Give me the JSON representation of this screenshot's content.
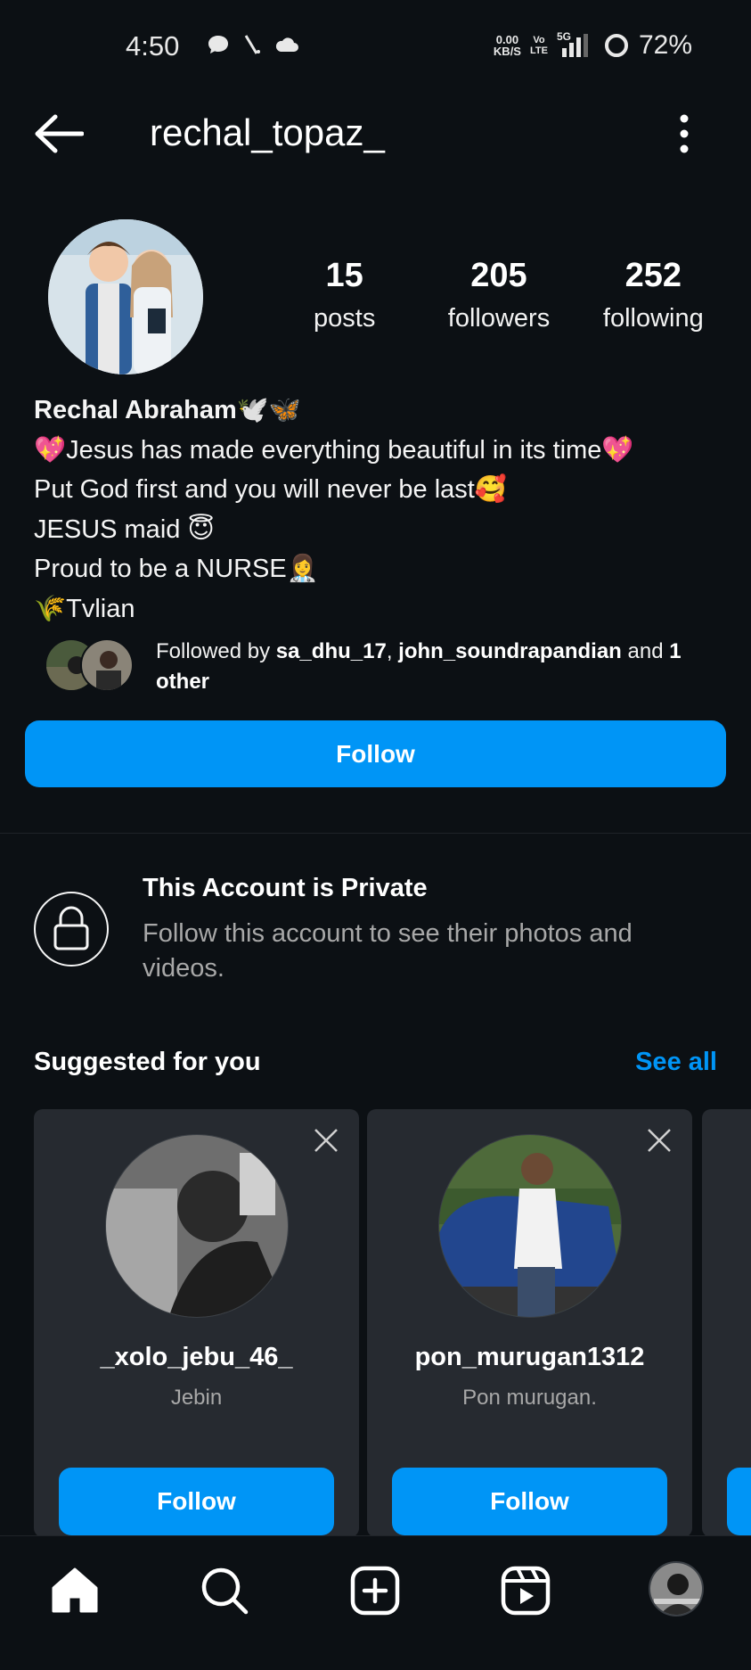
{
  "status_bar": {
    "time": "4:50",
    "net_speed_value": "0.00",
    "net_speed_unit": "KB/S",
    "volte_top": "Vo",
    "volte_bottom": "LTE",
    "network": "5G",
    "battery": "72%"
  },
  "header": {
    "username": "rechal_topaz_"
  },
  "profile": {
    "stats": [
      {
        "num": "15",
        "label": "posts"
      },
      {
        "num": "205",
        "label": "followers"
      },
      {
        "num": "252",
        "label": "following"
      }
    ],
    "name": "Rechal Abraham🕊️🦋",
    "bio": [
      "💖Jesus has made everything beautiful in its time💖",
      "Put God first and you will never be last🥰",
      "JESUS maid 😇",
      "Proud to be a NURSE👩‍⚕️",
      "🌾Tvlian"
    ],
    "followed_by": {
      "prefix": "Followed by ",
      "user1": "sa_dhu_17",
      "sep": ", ",
      "user2": "john_soundrapandian",
      "mid": " and ",
      "rest": "1 other"
    },
    "follow_label": "Follow"
  },
  "private": {
    "title": "This Account is Private",
    "subtitle": "Follow this account to see their photos and videos."
  },
  "suggested": {
    "title": "Suggested for you",
    "see_all": "See all",
    "cards": [
      {
        "username": "_xolo_jebu_46_",
        "name": "Jebin",
        "button": "Follow"
      },
      {
        "username": "pon_murugan1312",
        "name": "Pon murugan.",
        "button": "Follow"
      }
    ]
  },
  "nav": {
    "items": [
      "home-icon",
      "search-icon",
      "create-icon",
      "reels-icon",
      "profile-avatar"
    ]
  },
  "colors": {
    "background": "#0c1014",
    "accent": "#0095f6",
    "card": "#262a30",
    "muted": "#a8a8a8"
  }
}
